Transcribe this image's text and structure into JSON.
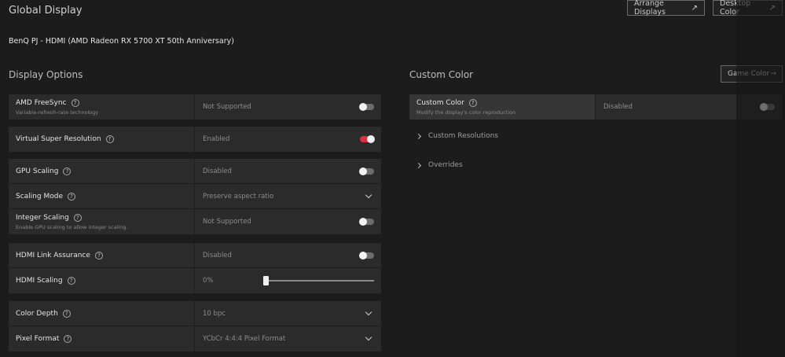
{
  "header": {
    "title": "Global Display",
    "arrange_displays_label": "Arrange Displays",
    "desktop_color_label": "Desktop Color",
    "arrow_glyph": "↗"
  },
  "display_name": "BenQ PJ - HDMI (AMD Radeon RX 5700 XT 50th Anniversary)",
  "display_options": {
    "title": "Display Options",
    "help_glyph": "?",
    "groups": [
      [
        {
          "label": "AMD FreeSync",
          "sublabel": "Variable-refresh-rate technology",
          "value": "Not Supported",
          "control": "toggle",
          "on": false
        }
      ],
      [
        {
          "label": "Virtual Super Resolution",
          "value": "Enabled",
          "control": "toggle",
          "on": true
        }
      ],
      [
        {
          "label": "GPU Scaling",
          "value": "Disabled",
          "control": "toggle",
          "on": false
        },
        {
          "label": "Scaling Mode",
          "value": "Preserve aspect ratio",
          "control": "dropdown"
        },
        {
          "label": "Integer Scaling",
          "sublabel": "Enable GPU scaling to allow integer scaling.",
          "value": "Not Supported",
          "control": "toggle",
          "on": false
        }
      ],
      [
        {
          "label": "HDMI Link Assurance",
          "value": "Disabled",
          "control": "toggle",
          "on": false
        },
        {
          "label": "HDMI Scaling",
          "value": "0%",
          "control": "slider",
          "level": 0
        }
      ],
      [
        {
          "label": "Color Depth",
          "value": "10 bpc",
          "control": "dropdown"
        },
        {
          "label": "Pixel Format",
          "value": "YCbCr 4:4:4 Pixel Format",
          "control": "dropdown"
        }
      ]
    ]
  },
  "custom_color": {
    "title": "Custom Color",
    "game_color_label": "Game Color",
    "game_color_arrow": "→",
    "row": {
      "label": "Custom Color",
      "sublabel": "Modify the display's color reproduction",
      "value": "Disabled",
      "on": false
    },
    "expanders": [
      "Custom Resolutions",
      "Overrides"
    ]
  },
  "colors": {
    "accent": "#d8303f",
    "panel": "#2b2b2b",
    "background": "#1c1c1c"
  }
}
